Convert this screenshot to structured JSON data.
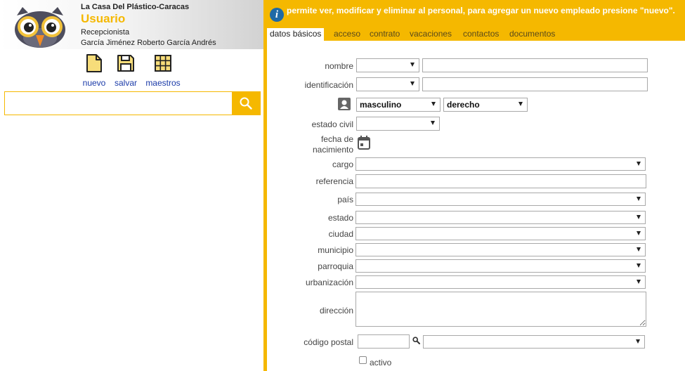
{
  "header": {
    "company": "La Casa Del Plástico-Caracas",
    "title": "Usuario",
    "role": "Recepcionista",
    "user_name": "García Jiménez Roberto García Andrés"
  },
  "toolbar": {
    "nuevo_label": "nuevo",
    "salvar_label": "salvar",
    "maestros_label": "maestros"
  },
  "search": {
    "value": "",
    "placeholder": ""
  },
  "info": {
    "text": "permite ver, modificar y eliminar al personal, para agregar un nuevo empleado presione \"nuevo\"."
  },
  "tabs": [
    {
      "label": "datos básicos",
      "active": true
    },
    {
      "label": "acceso"
    },
    {
      "label": "contrato"
    },
    {
      "label": "vacaciones"
    },
    {
      "label": "contactos"
    },
    {
      "label": "documentos"
    }
  ],
  "form": {
    "nombre": {
      "label": "nombre",
      "prefix_value": "",
      "value": ""
    },
    "identificacion": {
      "label": "identificación",
      "prefix_value": "",
      "value": ""
    },
    "sexo": {
      "value": "masculino"
    },
    "lateralidad": {
      "value": "derecho"
    },
    "estado_civil": {
      "label": "estado civil",
      "value": ""
    },
    "fecha_nacimiento": {
      "label_line1": "fecha de",
      "label_line2": "nacimiento"
    },
    "cargo": {
      "label": "cargo",
      "value": ""
    },
    "referencia": {
      "label": "referencia",
      "value": ""
    },
    "pais": {
      "label": "país",
      "value": ""
    },
    "estado": {
      "label": "estado",
      "value": ""
    },
    "ciudad": {
      "label": "ciudad",
      "value": ""
    },
    "municipio": {
      "label": "municipio",
      "value": ""
    },
    "parroquia": {
      "label": "parroquia",
      "value": ""
    },
    "urbanizacion": {
      "label": "urbanización",
      "value": ""
    },
    "direccion": {
      "label": "dirección",
      "value": ""
    },
    "codigo_postal": {
      "label": "código postal",
      "value": "",
      "select_value": ""
    },
    "activo": {
      "label": "activo",
      "checked": false
    }
  },
  "colors": {
    "accent": "#f5b800",
    "link": "#1a3aa8",
    "info_icon": "#1f6aa6"
  },
  "icons": {
    "logo": "owl-logo",
    "nuevo": "new-document-icon",
    "salvar": "floppy-disk-icon",
    "maestros": "grid-icon",
    "search": "search-icon",
    "info": "info-icon",
    "photo": "user-avatar-icon",
    "calendar": "calendar-icon",
    "postal_search": "magnifier-icon"
  }
}
